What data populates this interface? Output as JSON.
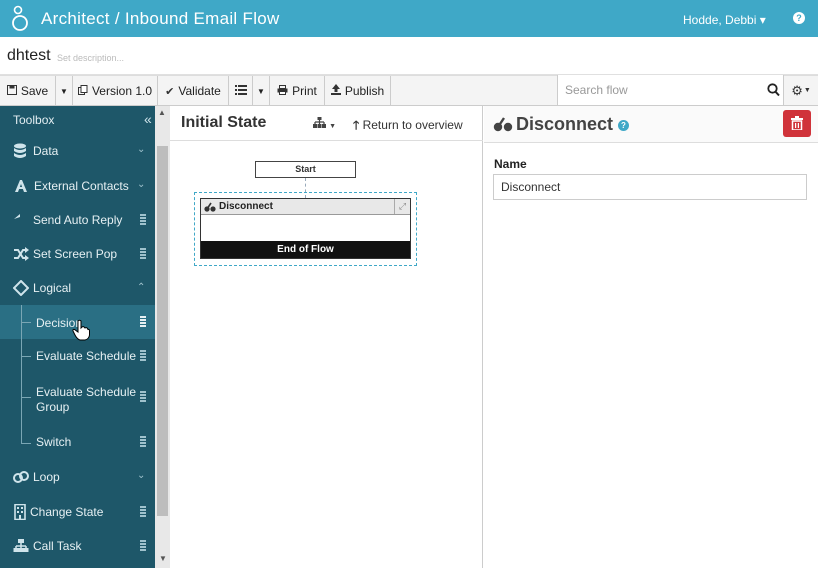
{
  "header": {
    "app_title": "Architect  /  Inbound Email Flow",
    "user": "Hodde, Debbi ▾",
    "help": "?"
  },
  "flow": {
    "name": "dhtest",
    "description_placeholder": "Set description..."
  },
  "toolbar": {
    "save": "Save",
    "version": "Version 1.0",
    "validate": "Validate",
    "print": "Print",
    "publish": "Publish",
    "search_placeholder": "Search flow"
  },
  "toolbox": {
    "title": "Toolbox",
    "items": [
      {
        "label": "Data",
        "icon": "database-icon"
      },
      {
        "label": "External Contacts",
        "icon": "contacts-icon"
      },
      {
        "label": "Send Auto Reply",
        "icon": "reply-icon"
      },
      {
        "label": "Set Screen Pop",
        "icon": "shuffle-icon"
      },
      {
        "label": "Logical",
        "icon": "diamond-icon"
      },
      {
        "label": "Loop",
        "icon": "loop-icon"
      },
      {
        "label": "Change State",
        "icon": "building-icon"
      },
      {
        "label": "Call Task",
        "icon": "sitemap-icon"
      }
    ],
    "logical_children": [
      {
        "label": "Decision"
      },
      {
        "label": "Evaluate Schedule"
      },
      {
        "label": "Evaluate Schedule Group"
      },
      {
        "label": "Switch"
      }
    ]
  },
  "canvas": {
    "state_title": "Initial State",
    "return_link": "Return to overview",
    "start_label": "Start",
    "node_title": "Disconnect",
    "node_footer": "End of Flow"
  },
  "properties": {
    "title": "Disconnect",
    "name_label": "Name",
    "name_value": "Disconnect"
  },
  "colors": {
    "header": "#3fa8c7",
    "toolbox_bg": "#1e5769",
    "delete": "#d0333a"
  }
}
